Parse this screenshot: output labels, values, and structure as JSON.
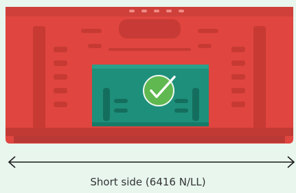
{
  "caption": "Short side (6416 N/LL)",
  "colors": {
    "background": "#e8f6ee",
    "crate": "#e0453f",
    "crate_dark": "#b93a35",
    "highlight": "#1e8f7a",
    "check": "#6cc04a"
  },
  "icons": {
    "check": "checkmark-circle-icon",
    "arrow": "double-headed-arrow-icon"
  }
}
